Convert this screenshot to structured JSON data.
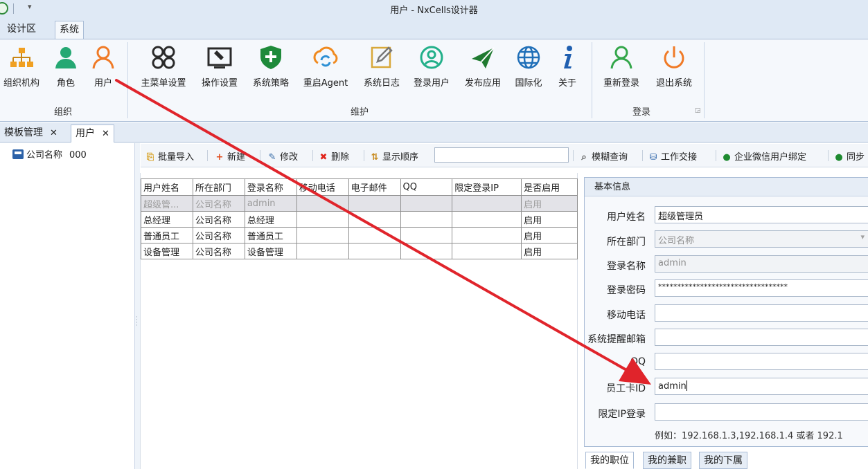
{
  "window": {
    "title": "用户 - NxCells设计器"
  },
  "ribbon": {
    "tabs": [
      {
        "label": "设计区"
      },
      {
        "label": "系统"
      }
    ],
    "groups": {
      "org": {
        "label": "组织",
        "buttons": [
          {
            "label": "组织机构",
            "icon": "org-chart-icon"
          },
          {
            "label": "角色",
            "icon": "role-icon"
          },
          {
            "label": "用户",
            "icon": "user-icon"
          }
        ]
      },
      "maintain": {
        "label": "维护",
        "buttons": [
          {
            "label": "主菜单设置",
            "icon": "menu-settings-icon"
          },
          {
            "label": "操作设置",
            "icon": "operation-settings-icon"
          },
          {
            "label": "系统策略",
            "icon": "shield-icon"
          },
          {
            "label": "重启Agent",
            "icon": "restart-icon"
          },
          {
            "label": "系统日志",
            "icon": "edit-log-icon"
          },
          {
            "label": "登录用户",
            "icon": "login-user-icon"
          },
          {
            "label": "发布应用",
            "icon": "send-icon"
          },
          {
            "label": "国际化",
            "icon": "globe-icon"
          },
          {
            "label": "关于",
            "icon": "info-icon"
          }
        ]
      },
      "login": {
        "label": "登录",
        "buttons": [
          {
            "label": "重新登录",
            "icon": "relogin-icon"
          },
          {
            "label": "退出系统",
            "icon": "power-icon"
          }
        ]
      }
    }
  },
  "doc_tabs": [
    {
      "label": "模板管理"
    },
    {
      "label": "用户"
    }
  ],
  "tree": {
    "root": {
      "name": "公司名称",
      "code": "000"
    }
  },
  "toolbar": {
    "batch_import": "批量导入",
    "new": "新建",
    "edit": "修改",
    "delete": "删除",
    "display_order": "显示顺序",
    "order_value": "",
    "fuzzy_search": "模糊查询",
    "handover": "工作交接",
    "wechat_bind": "企业微信用户绑定",
    "sync": "同步"
  },
  "grid": {
    "columns": [
      "用户姓名",
      "所在部门",
      "登录名称",
      "移动电话",
      "电子邮件",
      "QQ",
      "限定登录IP",
      "是否启用"
    ],
    "rows": [
      [
        "超级管...",
        "公司名称",
        "admin",
        "",
        "",
        "",
        "",
        "启用"
      ],
      [
        "总经理",
        "公司名称",
        "总经理",
        "",
        "",
        "",
        "",
        "启用"
      ],
      [
        "普通员工",
        "公司名称",
        "普通员工",
        "",
        "",
        "",
        "",
        "启用"
      ],
      [
        "设备管理",
        "公司名称",
        "设备管理",
        "",
        "",
        "",
        "",
        "启用"
      ]
    ]
  },
  "form": {
    "header": "基本信息",
    "fields": {
      "username": {
        "label": "用户姓名",
        "value": "超级管理员"
      },
      "department": {
        "label": "所在部门",
        "value": "公司名称"
      },
      "login_name": {
        "label": "登录名称",
        "value": "admin"
      },
      "password": {
        "label": "登录密码",
        "value": "**********************************"
      },
      "mobile": {
        "label": "移动电话",
        "value": ""
      },
      "remind_email": {
        "label": "系统提醒邮箱",
        "value": ""
      },
      "qq": {
        "label": "QQ",
        "value": ""
      },
      "card_id": {
        "label": "员工卡ID",
        "value": "admin"
      },
      "restrict_ip": {
        "label": "限定IP登录",
        "value": ""
      }
    },
    "hint": "例如：192.168.1.3,192.168.1.4  或者 192.1"
  },
  "bottom_tabs": [
    {
      "label": "我的职位"
    },
    {
      "label": "我的兼职"
    },
    {
      "label": "我的下属"
    }
  ],
  "colors": {
    "annotation_arrow": "#e0242b",
    "ribbon_bg": "#f5f8fc",
    "tab_strip": "#dfe9f5"
  }
}
